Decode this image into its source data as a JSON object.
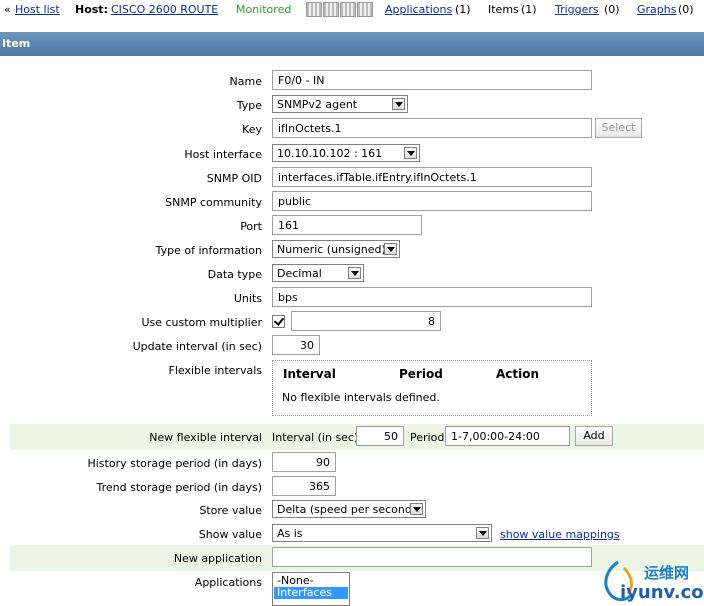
{
  "nav": {
    "back_symbol": "«",
    "host_list": "Host list",
    "host_label": "Host:",
    "host_name": "CISCO 2600 ROUTE",
    "status": "Monitored",
    "applications": "Applications",
    "applications_count": "(1)",
    "items": "Items",
    "items_count": "(1)",
    "triggers": "Triggers",
    "triggers_count": "(0)",
    "graphs": "Graphs",
    "graphs_count": "(0)"
  },
  "section": {
    "title": "Item"
  },
  "form": {
    "name_label": "Name",
    "name_value": "F0/0 - IN",
    "type_label": "Type",
    "type_value": "SNMPv2 agent",
    "key_label": "Key",
    "key_value": "ifInOctets.1",
    "select_button": "Select",
    "iface_label": "Host interface",
    "iface_value": "10.10.10.102 : 161",
    "oid_label": "SNMP OID",
    "oid_value": "interfaces.ifTable.ifEntry.ifInOctets.1",
    "community_label": "SNMP community",
    "community_value": "public",
    "port_label": "Port",
    "port_value": "161",
    "info_label": "Type of information",
    "info_value": "Numeric (unsigned)",
    "datatype_label": "Data type",
    "datatype_value": "Decimal",
    "units_label": "Units",
    "units_value": "bps",
    "multiplier_label": "Use custom multiplier",
    "multiplier_checked": true,
    "multiplier_value": "8",
    "interval_label": "Update interval (in sec)",
    "interval_value": "30",
    "flex_label": "Flexible intervals",
    "flex_col_interval": "Interval",
    "flex_col_period": "Period",
    "flex_col_action": "Action",
    "flex_empty": "No flexible intervals defined.",
    "newflex_label": "New flexible interval",
    "newflex_interval_label": "Interval (in sec)",
    "newflex_interval_value": "50",
    "newflex_period_label": "Period",
    "newflex_period_value": "1-7,00:00-24:00",
    "add_button": "Add",
    "history_label": "History storage period (in days)",
    "history_value": "90",
    "trend_label": "Trend storage period (in days)",
    "trend_value": "365",
    "store_label": "Store value",
    "store_value": "Delta (speed per second)",
    "show_label": "Show value",
    "show_value": "As is",
    "show_mappings": "show value mappings",
    "newapp_label": "New application",
    "newapp_value": "",
    "apps_label": "Applications",
    "apps_options": [
      "-None-",
      "Interfaces"
    ]
  },
  "watermark": {
    "cn": "运维网",
    "en": "iyunv.com"
  },
  "colors": {
    "header": "#4a77a4",
    "link": "#0a2bb4",
    "monitored": "#2f9b2f",
    "row_highlight": "#eaf5e4",
    "selection": "#3399ff"
  }
}
